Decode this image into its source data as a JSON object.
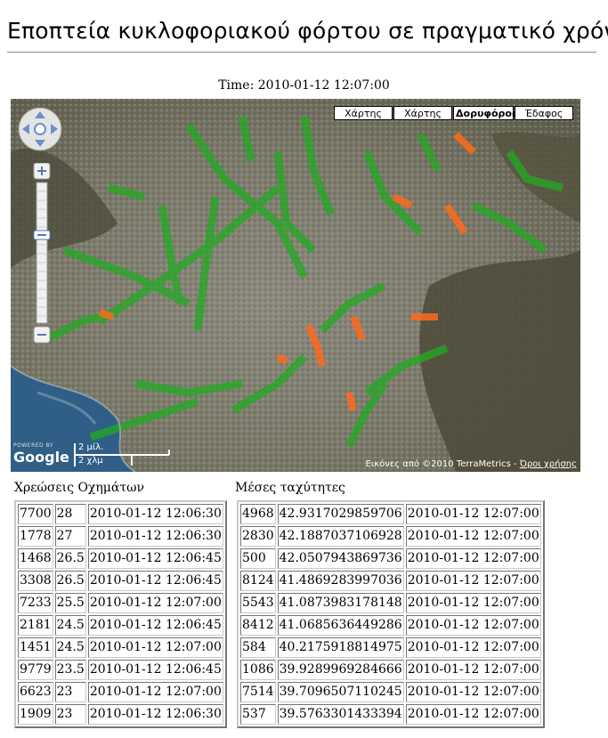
{
  "page": {
    "title": "Εποπτεία κυκλοφοριακού φόρτου σε πραγματικό χρόνο",
    "time_label": "Time:",
    "time_value": "2010-01-12 12:07:00"
  },
  "map": {
    "map_types": [
      {
        "label": "Χάρτης",
        "selected": false
      },
      {
        "label": "Χάρτης",
        "selected": false
      },
      {
        "label": "Δορυφόρος",
        "selected": true
      },
      {
        "label": "Έδαφος",
        "selected": false
      }
    ],
    "scale": {
      "top": "2 μίλ.",
      "bottom": "2 χλμ"
    },
    "logo_small": "POWERED BY",
    "logo": "Google",
    "copyright": "Εικόνες από ©2010 TerraMetrics -",
    "terms_link": "Όροι χρήσης",
    "colors": {
      "low_load": "#22aa22",
      "high_load": "#ff6a1a"
    }
  },
  "charges": {
    "caption": "Χρεώσεις Οχημάτων",
    "rows": [
      [
        "7700",
        "28",
        "2010-01-12 12:06:30"
      ],
      [
        "1778",
        "27",
        "2010-01-12 12:06:30"
      ],
      [
        "1468",
        "26.5",
        "2010-01-12 12:06:45"
      ],
      [
        "3308",
        "26.5",
        "2010-01-12 12:06:45"
      ],
      [
        "7233",
        "25.5",
        "2010-01-12 12:07:00"
      ],
      [
        "2181",
        "24.5",
        "2010-01-12 12:06:45"
      ],
      [
        "1451",
        "24.5",
        "2010-01-12 12:07:00"
      ],
      [
        "9779",
        "23.5",
        "2010-01-12 12:06:45"
      ],
      [
        "6623",
        "23",
        "2010-01-12 12:07:00"
      ],
      [
        "1909",
        "23",
        "2010-01-12 12:06:30"
      ]
    ]
  },
  "speeds": {
    "caption": "Μέσες ταχύτητες",
    "rows": [
      [
        "4968",
        "42.9317029859706",
        "2010-01-12 12:07:00"
      ],
      [
        "2830",
        "42.1887037106928",
        "2010-01-12 12:07:00"
      ],
      [
        "500",
        "42.0507943869736",
        "2010-01-12 12:07:00"
      ],
      [
        "8124",
        "41.4869283997036",
        "2010-01-12 12:07:00"
      ],
      [
        "5543",
        "41.0873983178148",
        "2010-01-12 12:07:00"
      ],
      [
        "8412",
        "41.0685636449286",
        "2010-01-12 12:07:00"
      ],
      [
        "584",
        "40.2175918814975",
        "2010-01-12 12:07:00"
      ],
      [
        "1086",
        "39.9289969284666",
        "2010-01-12 12:07:00"
      ],
      [
        "7514",
        "39.7096507110245",
        "2010-01-12 12:07:00"
      ],
      [
        "537",
        "39.5763301433394",
        "2010-01-12 12:07:00"
      ]
    ]
  }
}
